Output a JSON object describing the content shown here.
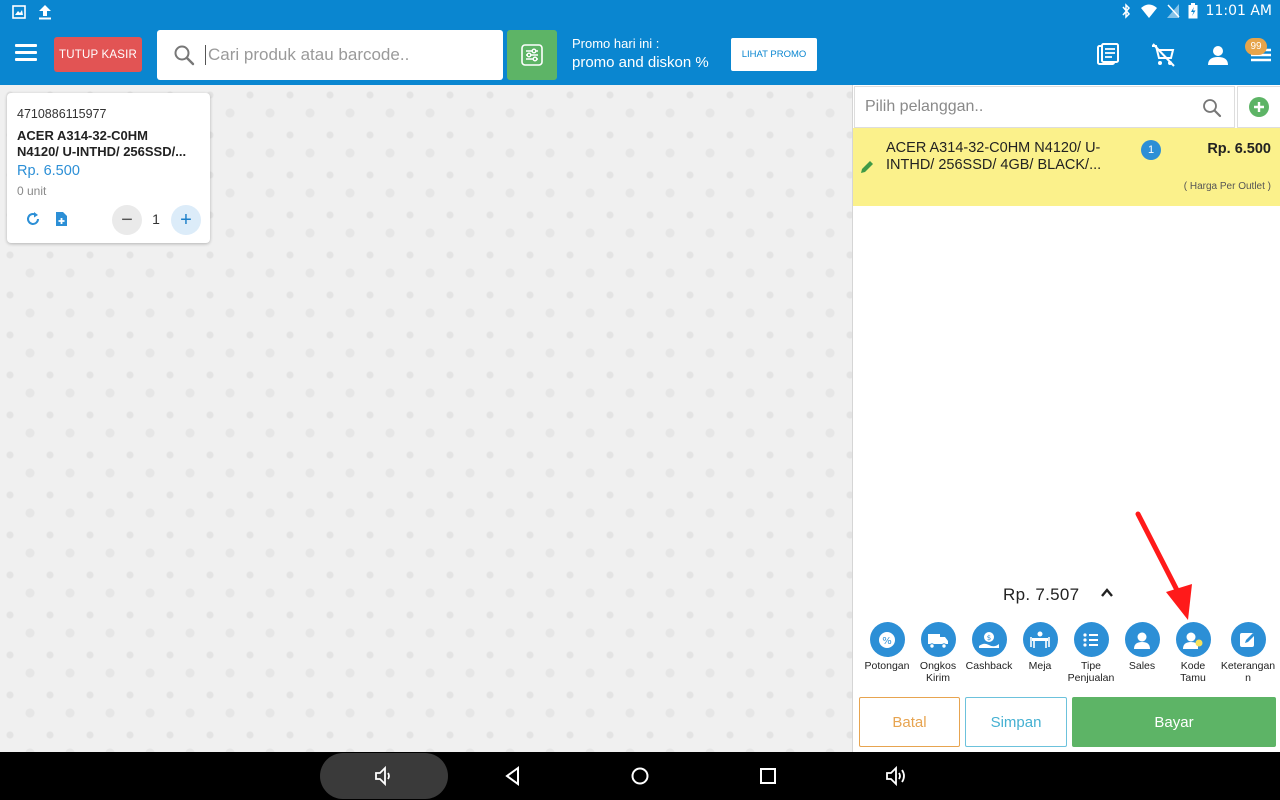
{
  "status_bar": {
    "time": "11:01 AM"
  },
  "appbar": {
    "close_label": "TUTUP KASIR",
    "search_placeholder": "Cari produk atau barcode..",
    "promo_title": "Promo hari ini :",
    "promo_desc": "promo and diskon %",
    "promo_button": "LIHAT PROMO",
    "badge_count": "99"
  },
  "product": {
    "barcode": "4710886115977",
    "name_line1": "ACER A314-32-C0HM",
    "name_line2": "N4120/ U-INTHD/ 256SSD/...",
    "price": "Rp. 6.500",
    "unit": "0 unit",
    "qty": "1"
  },
  "cart": {
    "customer_placeholder": "Pilih pelanggan..",
    "item": {
      "name_line1": "ACER A314-32-C0HM N4120/ U-",
      "name_line2": "INTHD/ 256SSD/ 4GB/ BLACK/...",
      "qty": "1",
      "price": "Rp. 6.500",
      "note": "( Harga Per Outlet )"
    },
    "total": "Rp. 7.507",
    "actions": [
      {
        "line1": "Potongan",
        "line2": ""
      },
      {
        "line1": "Ongkos",
        "line2": "Kirim"
      },
      {
        "line1": "Cashback",
        "line2": ""
      },
      {
        "line1": "Meja",
        "line2": ""
      },
      {
        "line1": "Tipe",
        "line2": "Penjualan"
      },
      {
        "line1": "Sales",
        "line2": ""
      },
      {
        "line1": "Kode",
        "line2": "Tamu"
      },
      {
        "line1": "Keterangan",
        "line2": "n"
      }
    ],
    "cancel_label": "Batal",
    "save_label": "Simpan",
    "pay_label": "Bayar"
  },
  "colors": {
    "primary": "#0a86d0",
    "danger": "#e25454",
    "success": "#5db466",
    "highlight": "#fbf18b",
    "accent_blue": "#2c8fd6",
    "annotation": "#ff1a1a"
  }
}
